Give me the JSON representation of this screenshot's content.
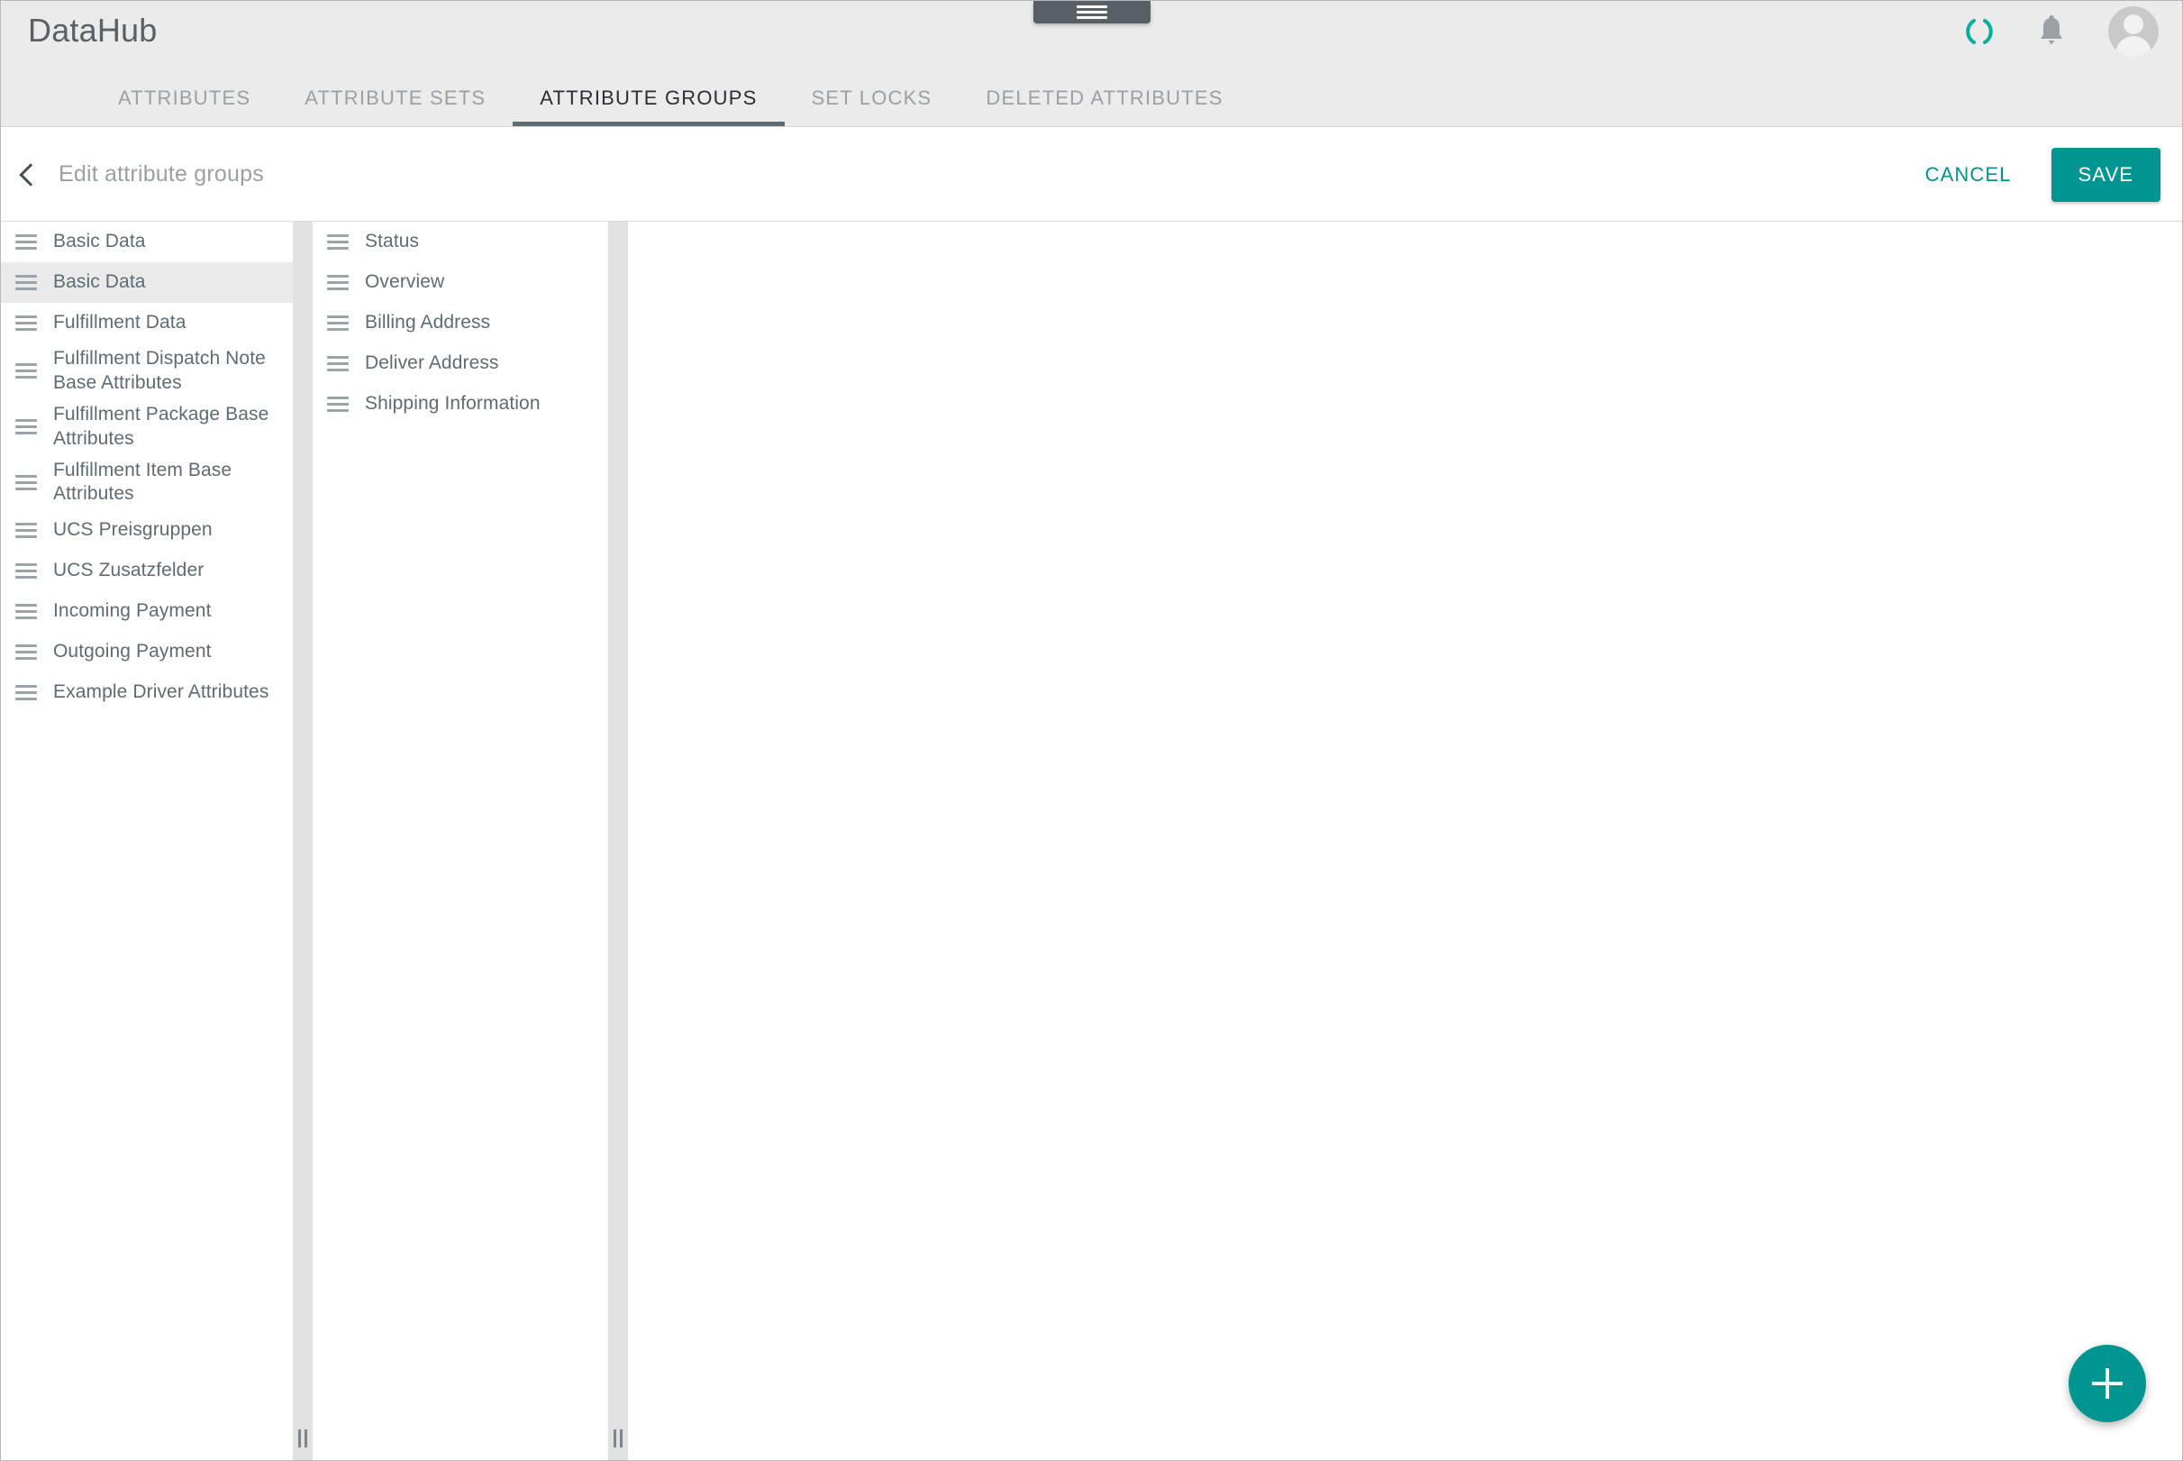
{
  "app": {
    "brand": "DataHub",
    "drawer_handle_icon": "hamburger-menu-icon"
  },
  "header": {
    "icons": {
      "loading": "loading-spinner-icon",
      "notifications": "bell-icon",
      "account": "user-avatar-icon"
    },
    "accent_color": "#009591",
    "background_color": "#ebebeb"
  },
  "tabs": [
    {
      "label": "ATTRIBUTES",
      "active": false
    },
    {
      "label": "ATTRIBUTE SETS",
      "active": false
    },
    {
      "label": "ATTRIBUTE GROUPS",
      "active": true
    },
    {
      "label": "SET LOCKS",
      "active": false
    },
    {
      "label": "DELETED ATTRIBUTES",
      "active": false
    }
  ],
  "sub_header": {
    "back_icon": "chevron-left-icon",
    "title": "Edit attribute groups",
    "cancel_label": "CANCEL",
    "save_label": "SAVE"
  },
  "columns": {
    "group_list": [
      {
        "label": "Basic Data",
        "selected": false
      },
      {
        "label": "Basic Data",
        "selected": true
      },
      {
        "label": "Fulfillment Data",
        "selected": false
      },
      {
        "label": "Fulfillment Dispatch Note Base Attributes",
        "selected": false
      },
      {
        "label": "Fulfillment Package Base Attributes",
        "selected": false
      },
      {
        "label": "Fulfillment Item Base Attributes",
        "selected": false
      },
      {
        "label": "UCS Preisgruppen",
        "selected": false
      },
      {
        "label": "UCS Zusatzfelder",
        "selected": false
      },
      {
        "label": "Incoming Payment",
        "selected": false
      },
      {
        "label": "Outgoing Payment",
        "selected": false
      },
      {
        "label": "Example Driver Attributes",
        "selected": false
      }
    ],
    "subgroup_list": [
      {
        "label": "Status",
        "selected": false
      },
      {
        "label": "Overview",
        "selected": false
      },
      {
        "label": "Billing Address",
        "selected": false
      },
      {
        "label": "Deliver Address",
        "selected": false
      },
      {
        "label": "Shipping Information",
        "selected": false
      }
    ],
    "detail_list": []
  },
  "fab": {
    "icon": "plus-icon",
    "color": "#009591"
  }
}
